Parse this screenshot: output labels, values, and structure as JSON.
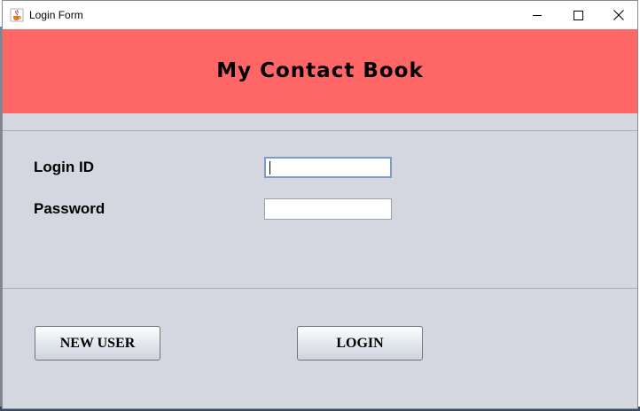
{
  "window": {
    "title": "Login Form",
    "app_icon": "java-cup-icon",
    "controls": [
      "minimize-icon",
      "maximize-icon",
      "close-icon"
    ]
  },
  "header": {
    "title": "My Contact Book",
    "background": "#ff6666"
  },
  "form": {
    "login_id_label": "Login ID",
    "login_id_value": "",
    "password_label": "Password",
    "password_value": ""
  },
  "buttons": {
    "new_user": "NEW USER",
    "login": "LOGIN"
  },
  "colors": {
    "panel": "#d4d7df",
    "focus_border": "#7a9cc6"
  }
}
